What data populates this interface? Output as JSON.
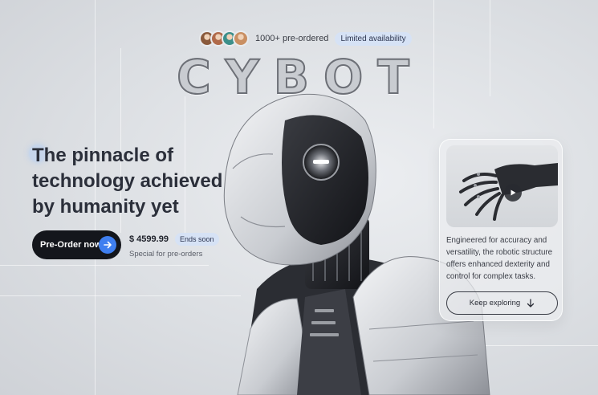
{
  "hero": {
    "preordered_text": "1000+ pre-ordered",
    "availability_badge": "Limited availability",
    "brand": "CYBOT",
    "headline": "The pinnacle of technology achieved by humanity yet",
    "preorder_label": "Pre-Order now",
    "price": "$ 4599.99",
    "ends_badge": "Ends soon",
    "special_note": "Special for pre-orders",
    "avatars": [
      {
        "color": "#8a5a3c"
      },
      {
        "color": "#b06a4a"
      },
      {
        "color": "#3c8f8a"
      },
      {
        "color": "#c98f62"
      }
    ]
  },
  "card": {
    "description": "Engineered for accuracy and versatility, the robotic structure offers enhanced dexterity and control for complex tasks.",
    "explore_label": "Keep exploring"
  },
  "colors": {
    "accent": "#3f7ff0",
    "dark": "#14161c",
    "badge_bg": "#d6e2f5"
  },
  "icons": [
    "arrow-right-icon",
    "play-icon",
    "arrow-down-icon"
  ]
}
